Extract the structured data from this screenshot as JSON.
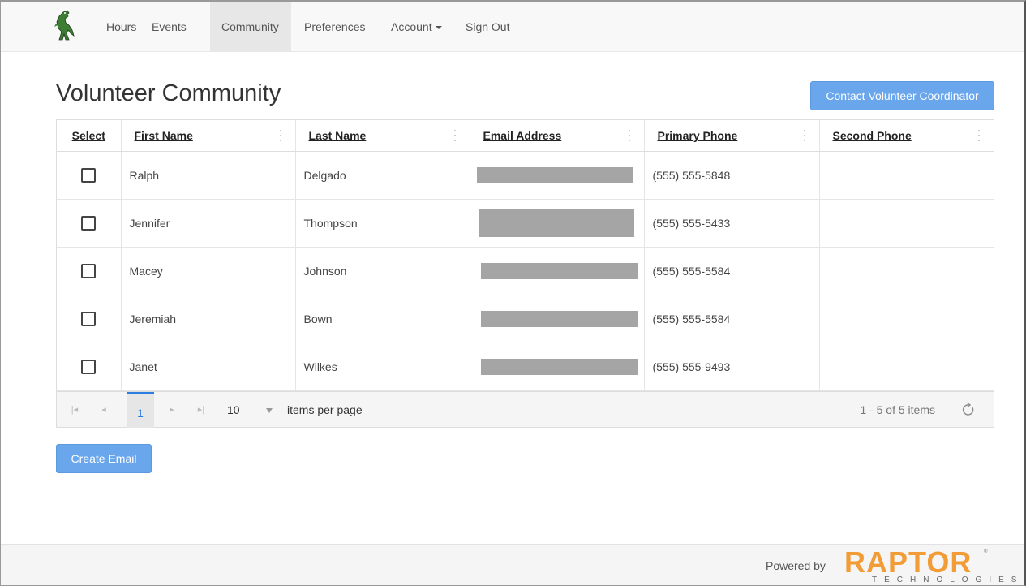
{
  "nav": {
    "items": [
      {
        "label": "Hours",
        "active": false
      },
      {
        "label": "Events",
        "active": false
      },
      {
        "label": "Community",
        "active": true
      },
      {
        "label": "Preferences",
        "active": false
      },
      {
        "label": "Account",
        "active": false,
        "dropdown": true
      },
      {
        "label": "Sign Out",
        "active": false
      }
    ]
  },
  "page": {
    "title": "Volunteer Community",
    "contact_button": "Contact Volunteer Coordinator",
    "create_email_button": "Create Email"
  },
  "grid": {
    "columns": [
      "Select",
      "First Name",
      "Last Name",
      "Email Address",
      "Primary Phone",
      "Second Phone"
    ],
    "rows": [
      {
        "first": "Ralph",
        "last": "Delgado",
        "email": "",
        "primary_phone": "(555) 555-5848",
        "second_phone": ""
      },
      {
        "first": "Jennifer",
        "last": "Thompson",
        "email": "",
        "primary_phone": "(555) 555-5433",
        "second_phone": ""
      },
      {
        "first": "Macey",
        "last": "Johnson",
        "email": "",
        "primary_phone": "(555) 555-5584",
        "second_phone": ""
      },
      {
        "first": "Jeremiah",
        "last": "Bown",
        "email": "",
        "primary_phone": "(555) 555-5584",
        "second_phone": ""
      },
      {
        "first": "Janet",
        "last": "Wilkes",
        "email": "",
        "primary_phone": "(555) 555-9493",
        "second_phone": ""
      }
    ]
  },
  "pager": {
    "current_page": "1",
    "page_size": "10",
    "items_per_page_label": "items per page",
    "info": "1 - 5 of 5 items"
  },
  "footer": {
    "powered_by": "Powered by",
    "brand": "RAPTOR",
    "brand_sub": "TECHNOLOGIES",
    "brand_color": "#f29c38"
  },
  "colors": {
    "primary_button": "#6aa6ec",
    "pager_active": "#2b7de1"
  }
}
